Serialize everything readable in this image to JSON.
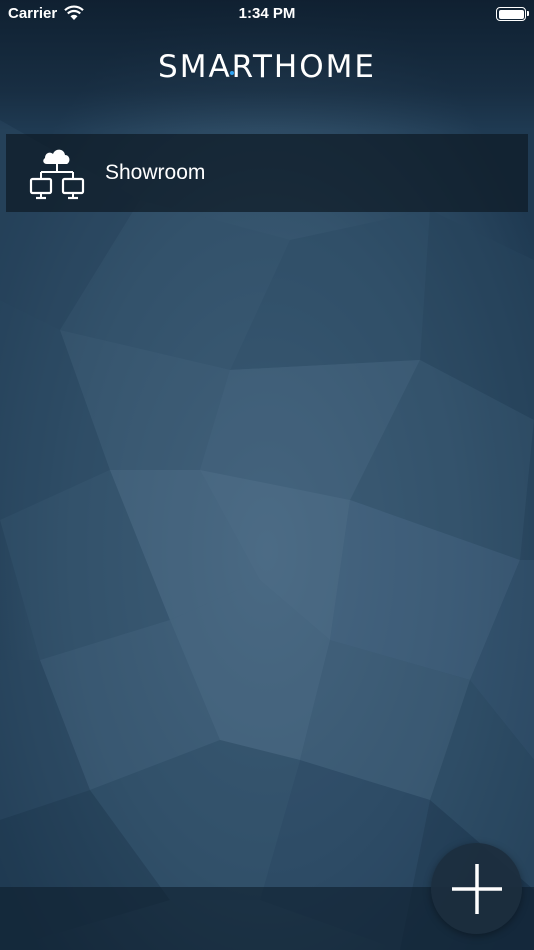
{
  "status_bar": {
    "carrier": "Carrier",
    "time": "1:34 PM"
  },
  "header": {
    "logo_text": "SMARTHOME",
    "logo_accent_color": "#2ea3f2"
  },
  "gateways": [
    {
      "label": "Showroom",
      "icon": "network-cloud-icon"
    }
  ],
  "fab": {
    "icon": "plus-icon"
  },
  "colors": {
    "background": "#2c4a63",
    "list_item_bg": "#0e1a26",
    "accent": "#2ea3f2"
  }
}
